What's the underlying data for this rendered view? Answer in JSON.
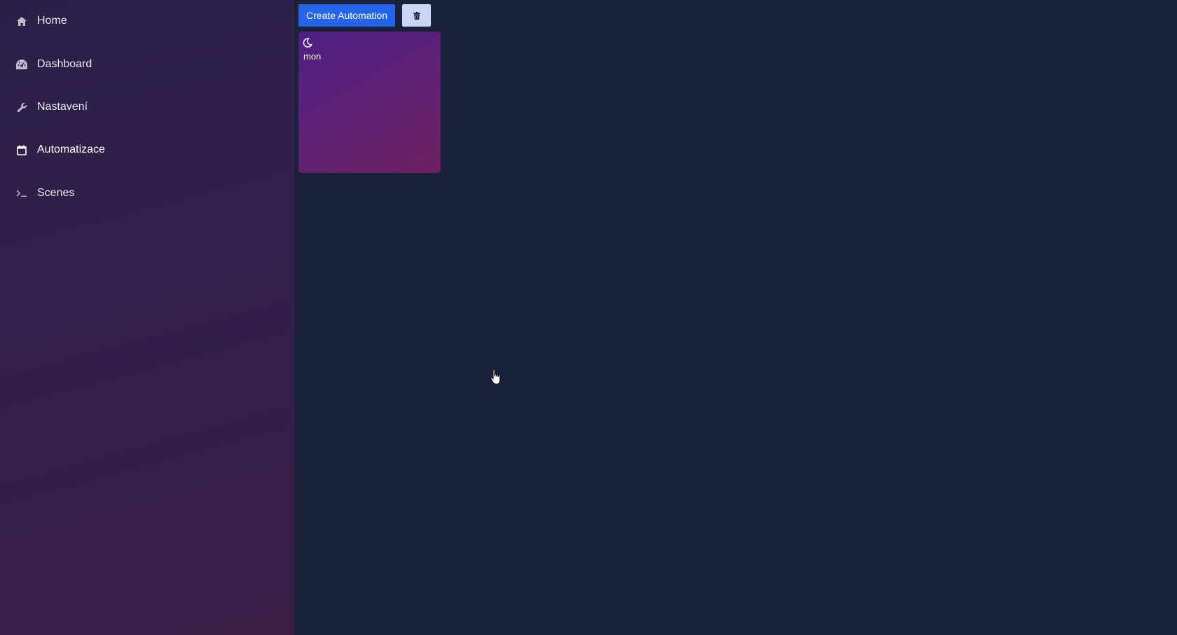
{
  "sidebar": {
    "items": [
      {
        "label": "Home",
        "icon": "home-icon"
      },
      {
        "label": "Dashboard",
        "icon": "dashboard-icon"
      },
      {
        "label": "Nastavení",
        "icon": "wrench-icon"
      },
      {
        "label": "Automatizace",
        "icon": "calendar-icon",
        "active": true
      },
      {
        "label": "Scenes",
        "icon": "terminal-icon"
      }
    ]
  },
  "toolbar": {
    "create_label": "Create Automation",
    "delete_icon": "trash-icon"
  },
  "automations": [
    {
      "label": "mon",
      "icon": "moon-icon"
    }
  ],
  "colors": {
    "accent": "#2563eb",
    "background": "#19223a",
    "card": "#5e2174"
  }
}
